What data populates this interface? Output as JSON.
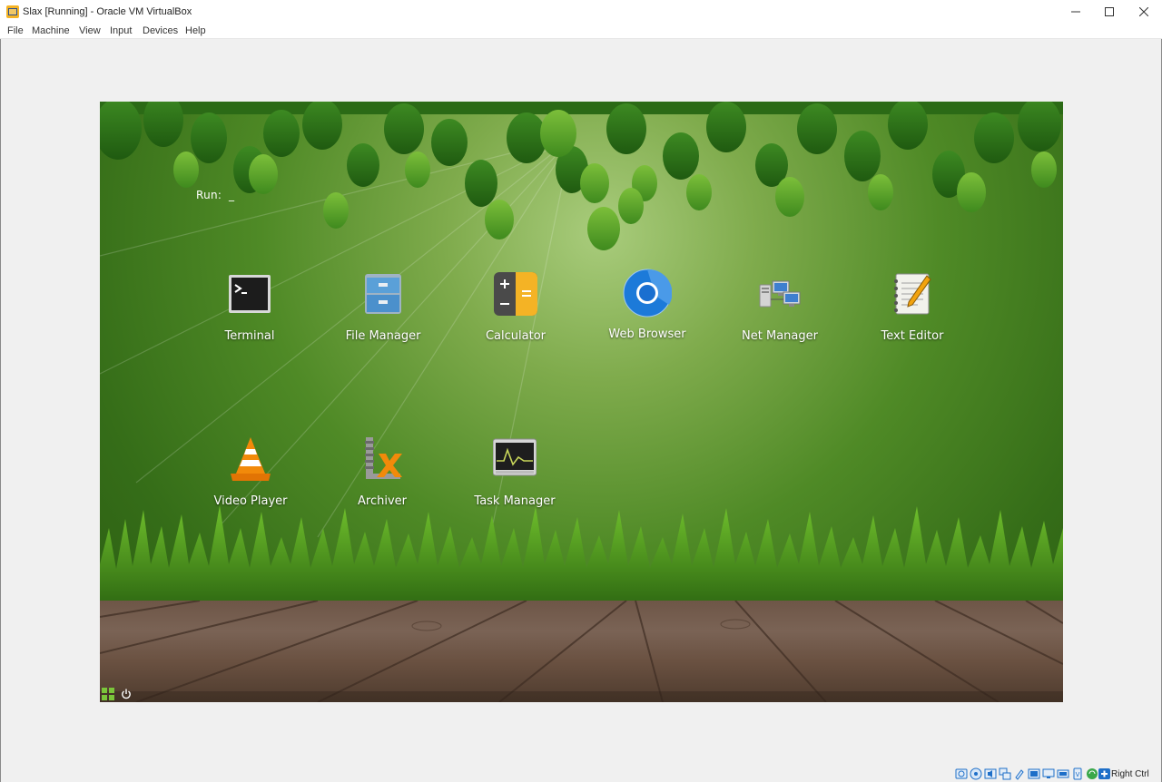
{
  "window": {
    "title": "Slax [Running] - Oracle VM VirtualBox",
    "minimize_label": "—",
    "maximize_label": "☐",
    "close_label": "✕"
  },
  "menubar": {
    "items": [
      "File",
      "Machine",
      "View",
      "Input",
      "Devices",
      "Help"
    ]
  },
  "desktop": {
    "run_label": "Run:",
    "run_cursor": "_",
    "icons": [
      {
        "label": "Terminal",
        "icon": "terminal-icon"
      },
      {
        "label": "File Manager",
        "icon": "file-manager-icon"
      },
      {
        "label": "Calculator",
        "icon": "calculator-icon"
      },
      {
        "label": "Web Browser",
        "icon": "web-browser-icon"
      },
      {
        "label": "Net Manager",
        "icon": "net-manager-icon"
      },
      {
        "label": "Text Editor",
        "icon": "text-editor-icon"
      },
      {
        "label": "Video Player",
        "icon": "video-player-icon"
      },
      {
        "label": "Archiver",
        "icon": "archiver-icon"
      },
      {
        "label": "Task Manager",
        "icon": "task-manager-icon"
      }
    ]
  },
  "taskbar": {
    "start_icon": "app-menu-icon",
    "power_icon": "power-icon"
  },
  "statusbar": {
    "host_key": "Right Ctrl",
    "icons": [
      "hard-disk-icon",
      "optical-drive-icon",
      "audio-icon",
      "network-icon",
      "usb-icon",
      "shared-folders-icon",
      "display-icon",
      "video-capture-icon",
      "cpu-icon",
      "mouse-integration-icon",
      "keyboard-icon"
    ]
  },
  "colors": {
    "desktop_green": "#4f8a26",
    "deck_brown": "#6e5647",
    "status_blue": "#1e6fc8"
  }
}
